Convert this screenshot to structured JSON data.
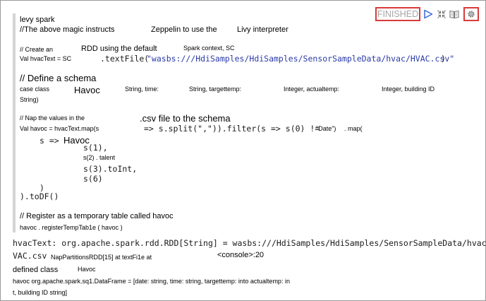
{
  "paragraph": {
    "status": "FINISHED",
    "toolbar_icons": [
      "run-icon",
      "collapse-icon",
      "book-icon",
      "gear-icon"
    ],
    "colors": {
      "highlight": "#d93a3a",
      "status_text": "#a6a6a6",
      "run": "#3a6bd8",
      "string": "#2a3aa8"
    }
  },
  "code": {
    "l1": "levy spark",
    "l2a": "//The above magic instructs",
    "l2b": "Zeppelin to use the",
    "l2c": "Livy interpreter",
    "l3a": "// Create an",
    "l3b": "RDD using the default",
    "l3c": "Spark context, SC",
    "l4a": "Val hvacText = SC",
    "l4b": ".textFile(",
    "l4c": "\"wasbs:///HdiSamples/HdiSamples/SensorSampleData/hvac/HVAC.csv\"",
    "l4d": ")",
    "l5": "// Define a schema",
    "l6a": "case class",
    "l6b": "Havoc",
    "l6c": "String, time:",
    "l6d": "String, targettemp:",
    "l6e": "Integer, actualtemp:",
    "l6f": "Integer, building ID",
    "l7": "String)",
    "l8a": "// Nap the values in the",
    "l8b": ".csv file to the schema",
    "l9a": "Val havoc = hvacText.map(s",
    "l9b": "=> s.split(\",\")).filter(s => s(0) != ",
    "l9c": "\"Date\")",
    "l9d": ". map(",
    "l10a": "s =>",
    "l10b": "Havoc",
    "l11": "s(1),",
    "l12": "s(2) . talent",
    "l13": "s(3).toInt,",
    "l14": "s(6)",
    "l15": ")",
    "l16": ").toDF()",
    "l17": "// Register as a temporary table called havoc",
    "l18": "havoc . registerTempTab1e ( havoc )"
  },
  "output": {
    "o1": "hvacText: org.apache.spark.rdd.RDD[String] = wasbs:///HdiSamples/HdiSamples/SensorSampleData/hvac/H",
    "o2a": "VAC.csv",
    "o2b": "NapPartitionsRDD[15] at textFi1e at",
    "o2c": "<console>:20",
    "o3a": "defined class",
    "o3b": "Havoc",
    "o4": "havoc org.apache.spark.sq1.DataFrame = [date: string, time: string, targettemp: into actualtemp: in",
    "o5": "t, building ID string]"
  }
}
